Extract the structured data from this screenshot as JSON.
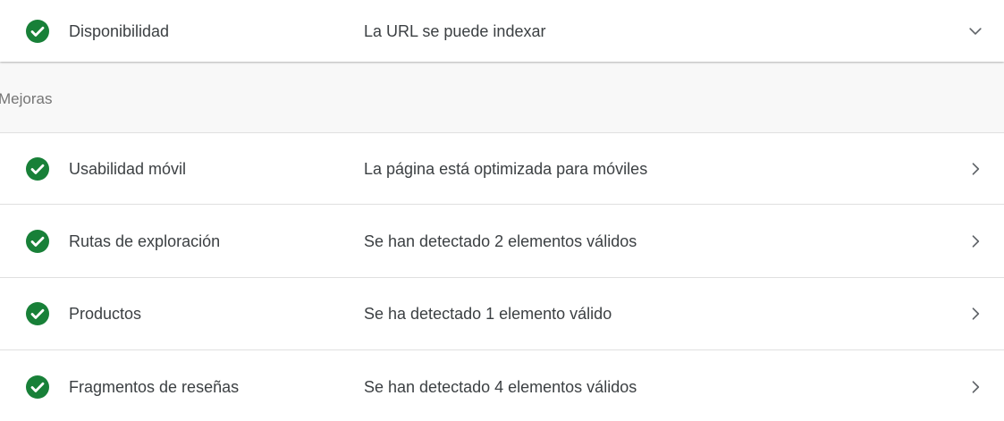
{
  "colors": {
    "status_ok": "#188038",
    "chevron": "#5f6368",
    "section_text": "#757575"
  },
  "availability": {
    "label": "Disponibilidad",
    "value": "La URL se puede indexar",
    "status_icon": "check-circle-icon",
    "toggle_icon": "chevron-down-icon"
  },
  "enhancements": {
    "title": "Mejoras",
    "items": [
      {
        "label": "Usabilidad móvil",
        "value": "La página está optimizada para móviles",
        "status_icon": "check-circle-icon",
        "nav_icon": "chevron-right-icon"
      },
      {
        "label": "Rutas de exploración",
        "value": "Se han detectado 2 elementos válidos",
        "status_icon": "check-circle-icon",
        "nav_icon": "chevron-right-icon"
      },
      {
        "label": "Productos",
        "value": "Se ha detectado 1 elemento válido",
        "status_icon": "check-circle-icon",
        "nav_icon": "chevron-right-icon"
      },
      {
        "label": "Fragmentos de reseñas",
        "value": "Se han detectado 4 elementos válidos",
        "status_icon": "check-circle-icon",
        "nav_icon": "chevron-right-icon"
      }
    ]
  }
}
